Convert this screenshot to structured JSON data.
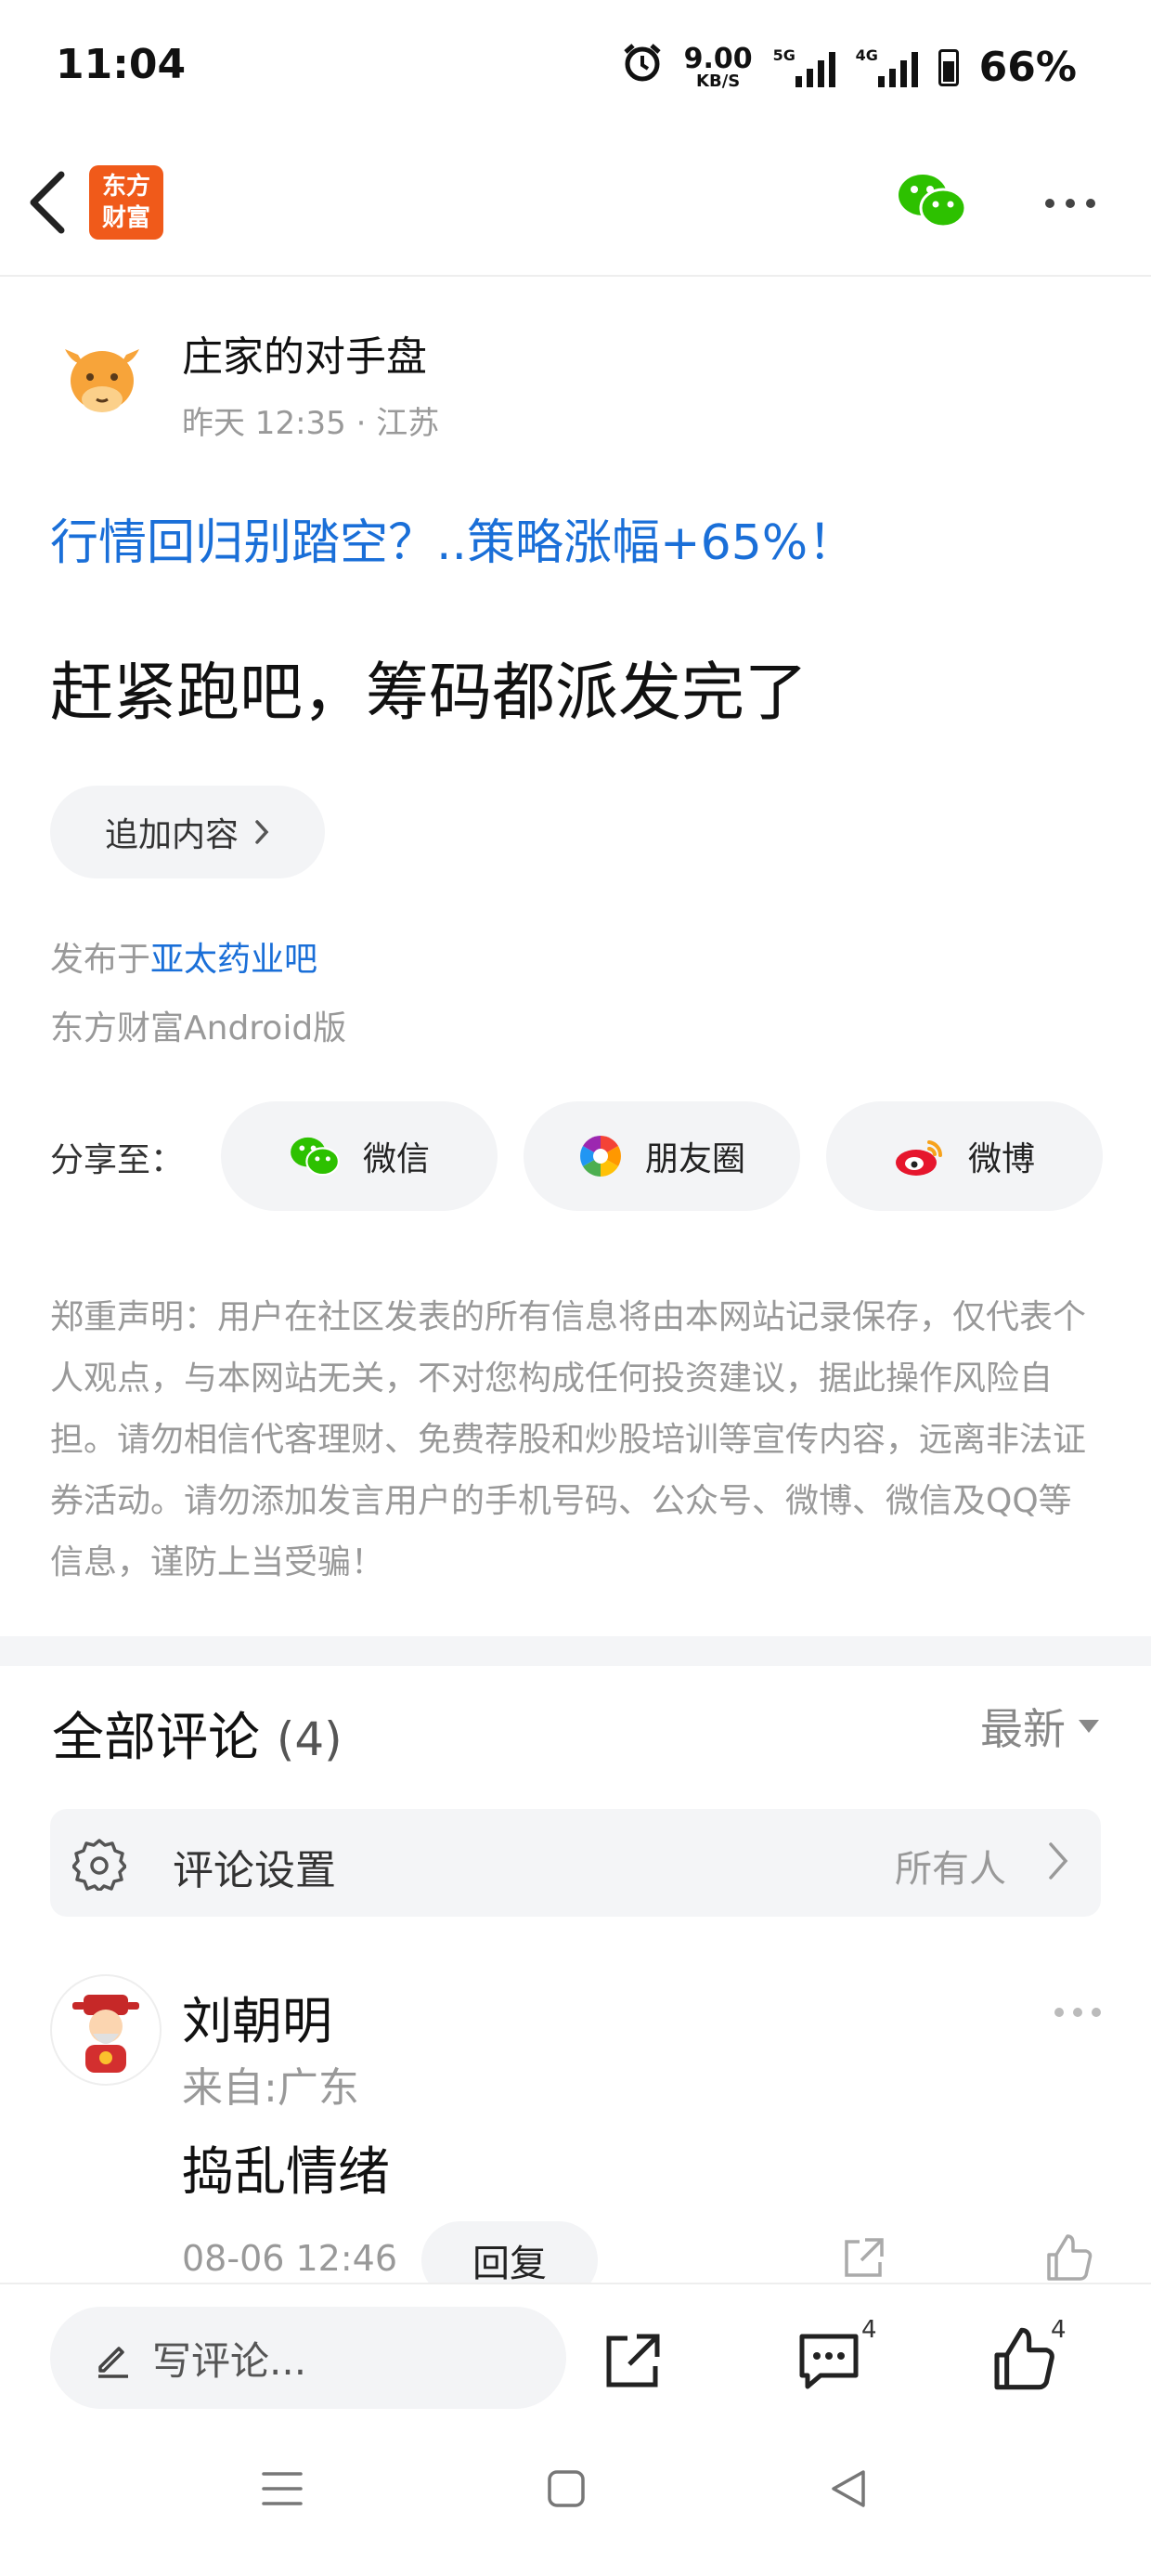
{
  "status_bar": {
    "time": "11:04",
    "net_speed": "9.00",
    "net_unit": "KB/S",
    "sig1_label": "5G",
    "sig2_label": "4G",
    "battery": "66%"
  },
  "nav": {
    "logo_line1": "东方",
    "logo_line2": "财富"
  },
  "post": {
    "author": "庄家的对手盘",
    "meta": "昨天 12:35 · 江苏",
    "promo_link": "行情回归别踏空？..策略涨幅+65%！",
    "title": "赶紧跑吧，筹码都派发完了",
    "append_label": "追加内容",
    "published_prefix": "发布于",
    "published_bar": "亚太药业吧",
    "platform": "东方财富Android版"
  },
  "share": {
    "label": "分享至：",
    "wechat": "微信",
    "moments": "朋友圈",
    "weibo": "微博"
  },
  "disclaimer": "郑重声明：用户在社区发表的所有信息将由本网站记录保存，仅代表个人观点，与本网站无关，不对您构成任何投资建议，据此操作风险自担。请勿相信代客理财、免费荐股和炒股培训等宣传内容，远离非法证券活动。请勿添加发言用户的手机号码、公众号、微博、微信及QQ等信息，谨防上当受骗！",
  "comments": {
    "title": "全部评论",
    "count": "(4)",
    "sort_label": "最新",
    "settings_label": "评论设置",
    "settings_value": "所有人",
    "items": [
      {
        "name": "刘朝明",
        "location": "来自:广东",
        "text": "捣乱情绪",
        "date": "08-06 12:46",
        "reply_label": "回复"
      }
    ]
  },
  "bottom_bar": {
    "write_placeholder": "写评论...",
    "comment_count": "4",
    "like_count": "4"
  },
  "colors": {
    "brand_orange": "#f05a1a",
    "link_blue": "#1a6fd8",
    "wechat_green": "#2dc100"
  }
}
